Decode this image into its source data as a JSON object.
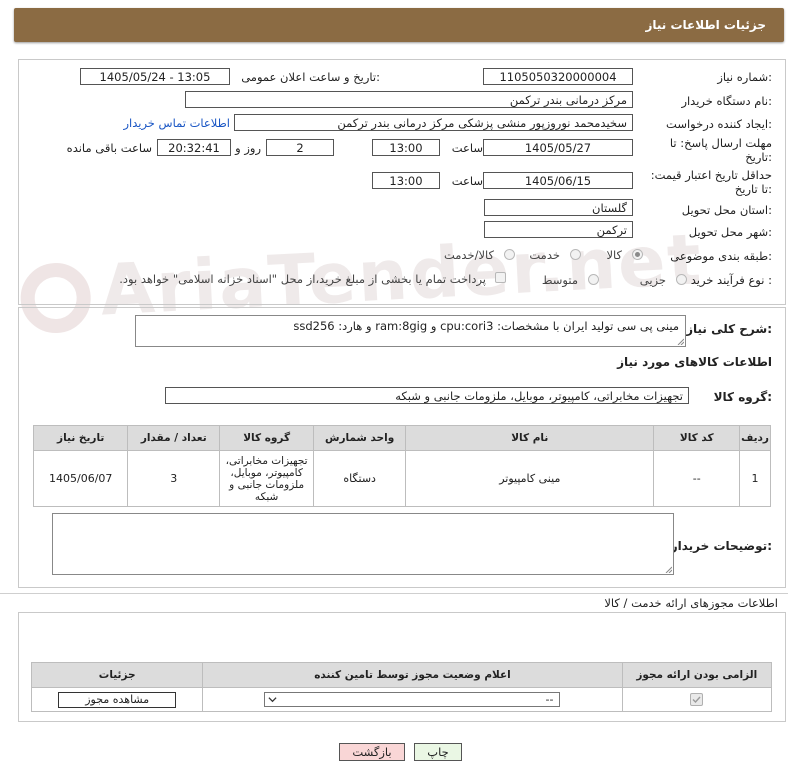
{
  "header": {
    "title": "جزئیات اطلاعات نیاز"
  },
  "form": {
    "need_number_label": "شماره نیاز:",
    "need_number": "1105050320000004",
    "announce_label": "تاریخ و ساعت اعلان عمومی:",
    "announce_value": "1405/05/24 - 13:05",
    "buyer_label": "نام دستگاه خریدار:",
    "buyer_value": "مرکز درمانی بندر ترکمن",
    "creator_label": "ایجاد کننده درخواست:",
    "creator_value": "سخیدمحمد نوروزپور منشی پزشکی مرکز درمانی بندر ترکمن",
    "contact_link": "اطلاعات تماس خریدار",
    "deadline_label": "مهلت ارسال پاسخ: تا تاریخ:",
    "deadline_date": "1405/05/27",
    "time_label": "ساعت",
    "deadline_time": "13:00",
    "days_value": "2",
    "days_label": "روز و",
    "remaining_time": "20:32:41",
    "remaining_label": "ساعت باقی مانده",
    "validity_label": "حداقل تاریخ اعتبار قیمت: تا تاریخ:",
    "validity_date": "1405/06/15",
    "validity_time": "13:00",
    "province_label": "استان محل تحویل:",
    "province_value": "گلستان",
    "city_label": "شهر محل تحویل:",
    "city_value": "ترکمن",
    "category_label": "طبقه بندی موضوعی:",
    "category_options": [
      "کالا",
      "خدمت",
      "کالا/خدمت"
    ],
    "purchase_label": "نوع فرآیند خرید :",
    "purchase_options": [
      "جزیی",
      "متوسط"
    ],
    "payment_note": "پرداخت تمام یا بخشی از مبلغ خرید،از محل \"اسناد خزانه اسلامی\" خواهد بود."
  },
  "description": {
    "label": "شرح کلی نیاز:",
    "text": "مینی پی سی تولید ایران با مشخصات: cpu:cori3 و ram:8gig و هارد: ssd256"
  },
  "goods": {
    "section_title": "اطلاعات کالاهای مورد نیاز",
    "group_label": "گروه کالا:",
    "group_value": "تجهیزات مخابراتی، کامپیوتر، موبایل، ملزومات جانبی و شبکه",
    "columns": [
      "ردیف",
      "کد کالا",
      "نام کالا",
      "واحد شمارش",
      "گروه کالا",
      "تعداد / مقدار",
      "تاریخ نیاز"
    ],
    "rows": [
      {
        "row": "1",
        "code": "--",
        "name": "مینی کامپیوتر",
        "unit": "دستگاه",
        "group": "تجهیزات مخابراتی، کامپیوتر، موبایل، ملزومات جانبی و شبکه",
        "qty": "3",
        "date": "1405/06/07"
      }
    ]
  },
  "buyer_notes": {
    "label": "توضیحات خریدار:"
  },
  "licenses": {
    "section_title": "اطلاعات مجوزهای ارائه خدمت / کالا",
    "columns": [
      "الزامی بودن ارائه مجوز",
      "اعلام وضعیت مجوز توسط تامین کننده",
      "جزئیات"
    ],
    "select_value": "--",
    "view_button": "مشاهده مجوز"
  },
  "footer": {
    "print_button": "چاپ",
    "back_button": "بازگشت"
  },
  "watermark": "AriaTender.net",
  "colors": {
    "header_bg": "#8b6b43",
    "link": "#1a56c4",
    "back_button_bg": "#f9d6d6",
    "print_button_bg": "#eaf7e4"
  }
}
